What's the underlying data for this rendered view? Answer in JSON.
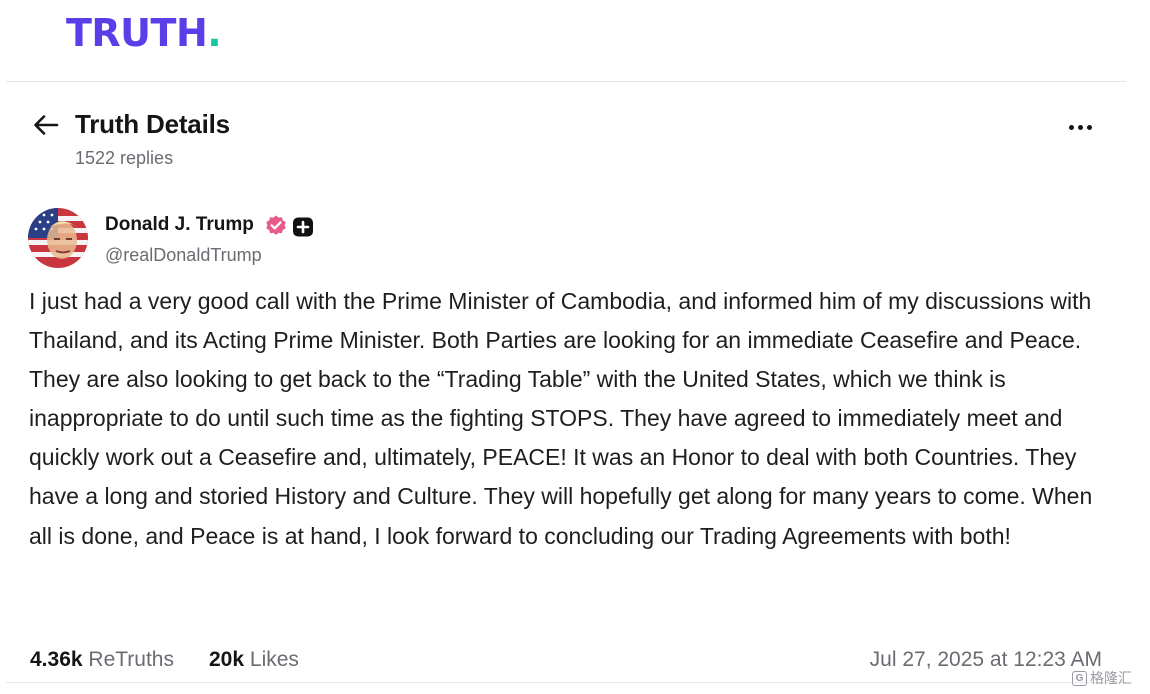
{
  "brand": {
    "logo_text": "TRUTH",
    "logo_dot": ".",
    "logo_color": "#5b3ee8",
    "dot_color": "#17c7a3"
  },
  "header": {
    "title": "Truth Details",
    "replies": "1522 replies",
    "back_icon": "arrow-left-icon",
    "more_icon": "more-horizontal-icon"
  },
  "author": {
    "name": "Donald J. Trump",
    "handle": "@realDonaldTrump",
    "verified_color": "#e85a8c"
  },
  "post": {
    "text": "I just had a very good call with the Prime Minister of Cambodia, and informed him of my discussions with Thailand, and its Acting Prime Minister. Both Parties are looking for an immediate Ceasefire and Peace. They are also looking to get back to the “Trading Table” with the United States, which we think is inappropriate to do until such time as the fighting STOPS. They have agreed to immediately meet and quickly work out a Ceasefire and, ultimately, PEACE! It was an Honor to deal with both Countries. They have a long and storied History and Culture. They will hopefully get along for many years to come. When all is done, and Peace is at hand, I look forward to concluding our Trading Agreements with both!"
  },
  "stats": {
    "retruths_count": "4.36k",
    "retruths_label": "ReTruths",
    "likes_count": "20k",
    "likes_label": "Likes",
    "timestamp": "Jul 27, 2025 at 12:23 AM"
  },
  "watermark": {
    "text": "格隆汇",
    "box": "G"
  }
}
